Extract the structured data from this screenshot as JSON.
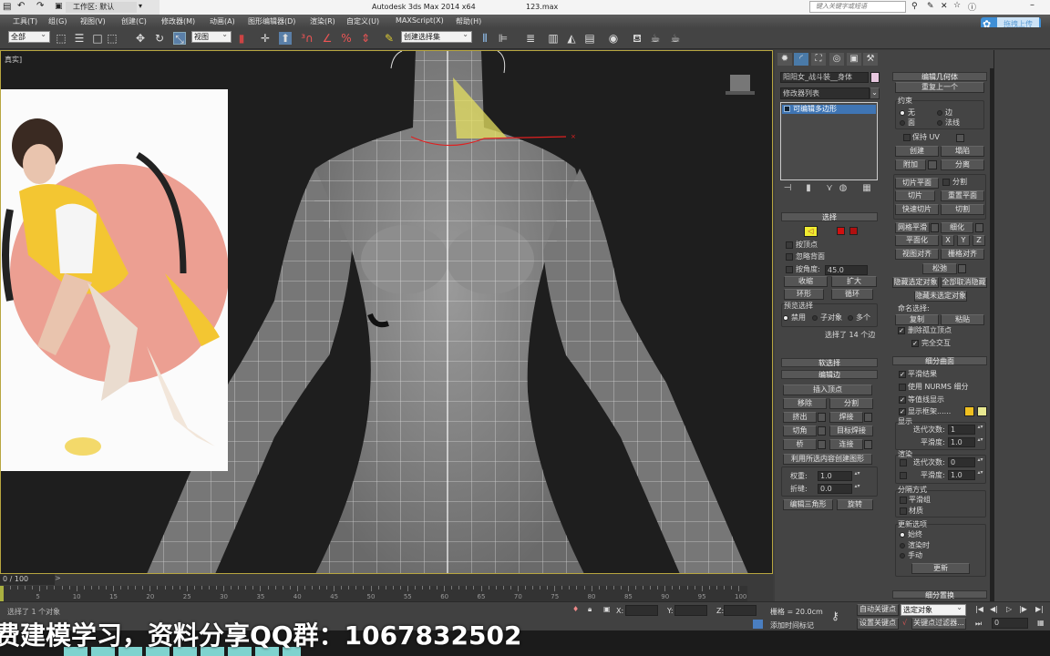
{
  "titlebar": {
    "workspace": "工作区: 默认",
    "title": "Autodesk 3ds Max  2014 x64",
    "file": "123.max",
    "search_placeholder": "键入关键字或短语"
  },
  "upload_button": "拖拽上传",
  "menu": [
    "工具(T)",
    "组(G)",
    "视图(V)",
    "创建(C)",
    "修改器(M)",
    "动画(A)",
    "图形编辑器(D)",
    "渲染(R)",
    "自定义(U)",
    "MAXScript(X)",
    "帮助(H)"
  ],
  "toolbar": {
    "selection_filter": "全部",
    "coord_system": "视图",
    "named_selection": "创建选择集"
  },
  "viewport": {
    "label": "真实]"
  },
  "cmd": {
    "object_name": "阳阳女_战斗装__身体",
    "modifier_list": "修改器列表",
    "stack_item": "可编辑多边形",
    "selection": {
      "title": "选择",
      "by_vertex": "按顶点",
      "ignore_backfacing": "忽略背面",
      "by_angle": "按角度:",
      "angle": "45.0",
      "shrink": "收缩",
      "grow": "扩大",
      "ring": "环形",
      "loop": "循环",
      "preview": "预览选择",
      "off": "禁用",
      "subobj": "子对象",
      "multi": "多个",
      "status": "选择了 14 个边"
    },
    "soft_selection": "软选择",
    "edit_edges": {
      "title": "编辑边",
      "insert_vertex": "插入顶点",
      "remove": "移除",
      "split": "分割",
      "extrude": "挤出",
      "weld": "焊接",
      "chamfer": "切角",
      "target_weld": "目标焊接",
      "bridge": "桥",
      "connect": "连接",
      "create_shape": "利用所选内容创建图形",
      "weight_label": "权重:",
      "weight": "1.0",
      "crease_label": "折缝:",
      "crease": "0.0",
      "edit_tri": "编辑三角形",
      "turn": "旋转"
    },
    "edit_geometry": {
      "title": "编辑几何体",
      "repeat": "重复上一个",
      "constraints": "约束",
      "none": "无",
      "edge": "边",
      "face": "面",
      "normal": "法线",
      "preserve_uv": "保持 UV",
      "create": "创建",
      "collapse": "塌陷",
      "attach": "附加",
      "detach": "分离",
      "slice_plane": "切片平面",
      "split": "分割",
      "slice": "切片",
      "reset_plane": "重置平面",
      "quickslice": "快速切片",
      "cut": "切割",
      "meshsmooth": "网格平滑",
      "tessellate": "细化",
      "make_planar": "平面化",
      "x": "X",
      "y": "Y",
      "z": "Z",
      "view_align": "视图对齐",
      "grid_align": "栅格对齐",
      "relax": "松弛",
      "hide_sel": "隐藏选定对象",
      "unhide_all": "全部取消隐藏",
      "hide_unsel": "隐藏未选定对象",
      "named_sel": "命名选择:",
      "copy": "复制",
      "paste": "粘贴",
      "delete_iso": "删除孤立顶点",
      "full_interact": "完全交互"
    },
    "subdivision": {
      "title": "细分曲面",
      "smooth_result": "平滑结果",
      "use_nurms": "使用 NURMS 细分",
      "isoline": "等值线显示",
      "show_cage": "显示框架......",
      "display": "显示",
      "iterations": "迭代次数:",
      "iter_val": "1",
      "smoothness": "平滑度:",
      "smooth_val": "1.0",
      "render": "渲染",
      "r_iter_val": "0",
      "r_smooth_val": "1.0",
      "separate_by": "分隔方式",
      "smoothing_groups": "平滑组",
      "materials": "材质",
      "update_options": "更新选项",
      "always": "始终",
      "when_rendering": "渲染时",
      "manually": "手动",
      "update": "更新",
      "cage_color1": "#f0c020",
      "cage_color2": "#e8e890"
    },
    "displacement": "细分置换"
  },
  "timeline": {
    "frame": "0 / 100",
    "ticks": [
      "5",
      "10",
      "15",
      "20",
      "25",
      "30",
      "35",
      "40",
      "45",
      "50",
      "55",
      "60",
      "65",
      "70",
      "75",
      "80",
      "85",
      "90",
      "95",
      "100"
    ]
  },
  "status": {
    "message": "选择了 1 个对象",
    "x": "X:",
    "y": "Y:",
    "z": "Z:",
    "grid": "栅格 = 20.0cm",
    "add_time_tag": "添加时间标记",
    "auto_key": "自动关键点",
    "set_key": "设置关键点",
    "key_mode": "选定对象",
    "key_filters": "关键点过滤器...",
    "current_frame": "0"
  },
  "subtitle": "费建模学习，资料分享QQ群：1067832502"
}
